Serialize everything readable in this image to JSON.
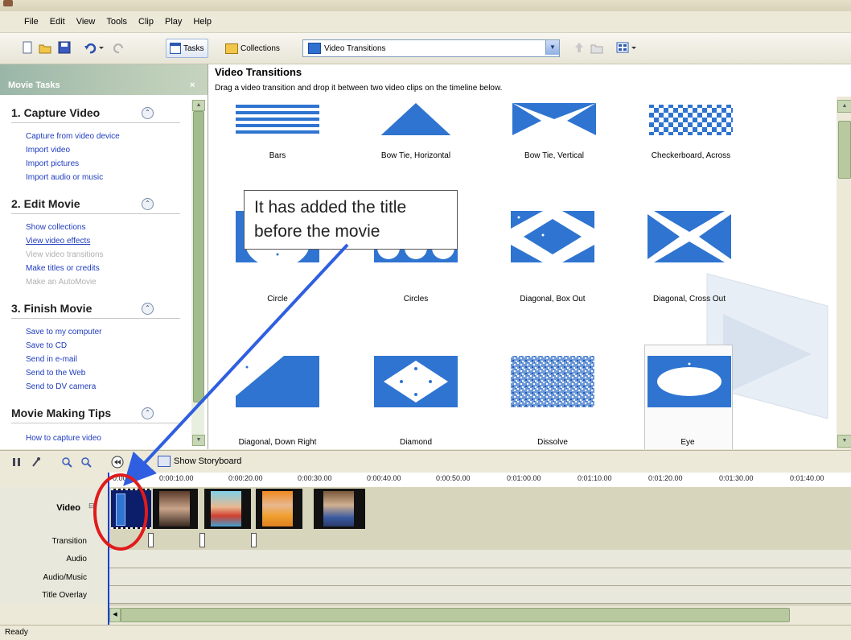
{
  "menu": [
    "File",
    "Edit",
    "View",
    "Tools",
    "Clip",
    "Play",
    "Help"
  ],
  "toolbar": {
    "tasks_label": "Tasks",
    "collections_label": "Collections",
    "combo_value": "Video Transitions"
  },
  "tasks_pane": {
    "header": "Movie Tasks",
    "close": "×",
    "sections": [
      {
        "title": "1. Capture Video",
        "links": [
          "Capture from video device",
          "Import video",
          "Import pictures",
          "Import audio or music"
        ]
      },
      {
        "title": "2. Edit Movie",
        "links": [
          "Show collections",
          "View video effects",
          "View video transitions",
          "Make titles or credits",
          "Make an AutoMovie"
        ]
      },
      {
        "title": "3. Finish Movie",
        "links": [
          "Save to my computer",
          "Save to CD",
          "Send in e-mail",
          "Send to the Web",
          "Send to DV camera"
        ]
      },
      {
        "title": "Movie Making Tips",
        "links": [
          "How to capture video"
        ]
      }
    ]
  },
  "main": {
    "title": "Video Transitions",
    "subtitle": "Drag a video transition and drop it between two video clips on the timeline below.",
    "transitions": [
      "Bars",
      "Bow Tie, Horizontal",
      "Bow Tie, Vertical",
      "Checkerboard, Across",
      "Circle",
      "Circles",
      "Diagonal, Box Out",
      "Diagonal, Cross Out",
      "Diagonal, Down Right",
      "Diamond",
      "Dissolve",
      "Eye"
    ]
  },
  "callout": {
    "line1": "It has added the title",
    "line2": "before the movie"
  },
  "timeline": {
    "show_storyboard": "Show Storyboard",
    "ruler_ticks": [
      "0:00",
      "0:00:10.00",
      "0:00:20.00",
      "0:00:30.00",
      "0:00:40.00",
      "0:00:50.00",
      "0:01:00.00",
      "0:01:10.00",
      "0:01:20.00",
      "0:01:30.00",
      "0:01:40.00"
    ],
    "tracks": [
      "Video",
      "Transition",
      "Audio",
      "Audio/Music",
      "Title Overlay"
    ]
  },
  "status": "Ready",
  "colors": {
    "accent_blue": "#2f74d0",
    "annotation_red": "#e01b1b",
    "arrow_blue": "#2f5fe0"
  }
}
